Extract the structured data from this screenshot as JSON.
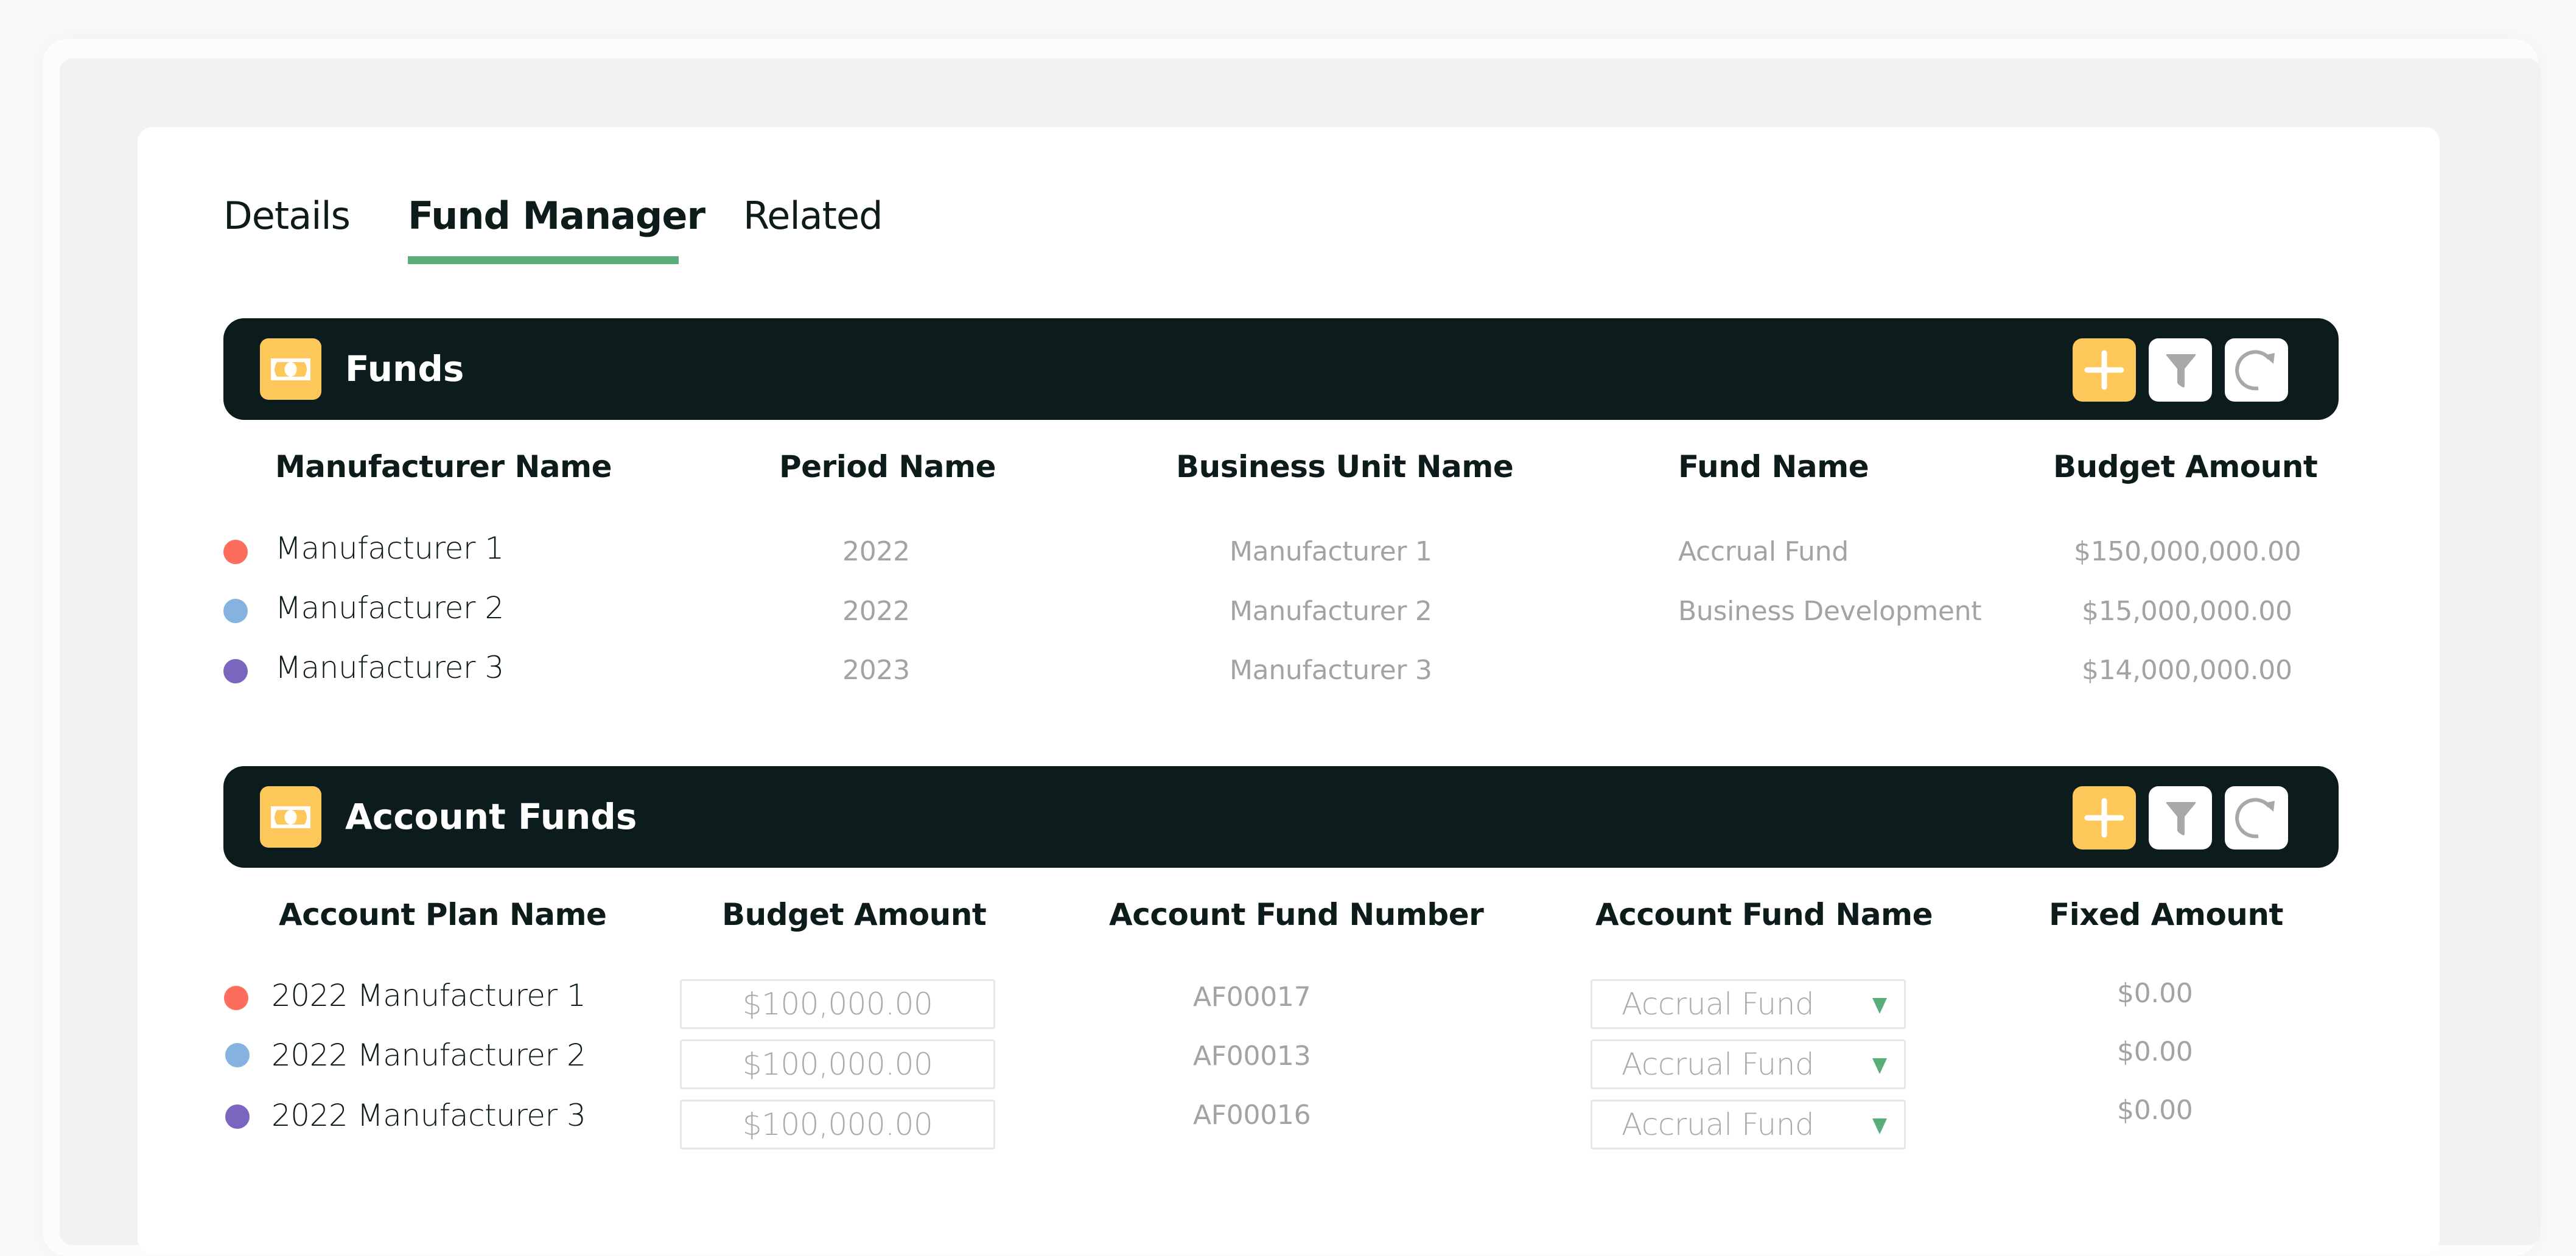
{
  "tabs": [
    {
      "label": "Details",
      "active": false
    },
    {
      "label": "Fund Manager",
      "active": true
    },
    {
      "label": "Related",
      "active": false
    }
  ],
  "colors": {
    "accent_green": "#58ad78",
    "header_bar": "#0c1c1c",
    "icon_yellow": "#fdc75a",
    "muted_text": "#a3a3a3",
    "dot_red": "#fd6d5e",
    "dot_blue": "#86b2e0",
    "dot_purple": "#7b66bf"
  },
  "funds": {
    "title": "Funds",
    "icon": "money-bill-icon",
    "actions": [
      {
        "name": "add",
        "icon": "plus-icon"
      },
      {
        "name": "filter",
        "icon": "filter-icon"
      },
      {
        "name": "refresh",
        "icon": "refresh-icon"
      }
    ],
    "columns": [
      "Manufacturer Name",
      "Period Name",
      "Business Unit Name",
      "Fund Name",
      "Budget Amount"
    ],
    "rows": [
      {
        "dot": "red",
        "manufacturer": "Manufacturer 1",
        "period": "2022",
        "business_unit": "Manufacturer 1",
        "fund_name": "Accrual Fund",
        "budget": "$150,000,000.00"
      },
      {
        "dot": "blue",
        "manufacturer": "Manufacturer 2",
        "period": "2022",
        "business_unit": "Manufacturer 2",
        "fund_name": "Business Development",
        "budget": "$15,000,000.00"
      },
      {
        "dot": "purple",
        "manufacturer": "Manufacturer 3",
        "period": "2023",
        "business_unit": "Manufacturer 3",
        "fund_name": "",
        "budget": "$14,000,000.00"
      }
    ]
  },
  "account_funds": {
    "title": "Account Funds",
    "icon": "money-bill-icon",
    "actions": [
      {
        "name": "add",
        "icon": "plus-icon"
      },
      {
        "name": "filter",
        "icon": "filter-icon"
      },
      {
        "name": "refresh",
        "icon": "refresh-icon"
      }
    ],
    "columns": [
      "Account Plan Name",
      "Budget Amount",
      "Account Fund Number",
      "Account Fund Name",
      "Fixed Amount"
    ],
    "rows": [
      {
        "dot": "red",
        "plan": "2022 Manufacturer 1",
        "budget": "$100,000.00",
        "number": "AF00017",
        "fund_name": "Accrual Fund",
        "fixed": "$0.00"
      },
      {
        "dot": "blue",
        "plan": "2022 Manufacturer 2",
        "budget": "$100,000.00",
        "number": "AF00013",
        "fund_name": "Accrual Fund",
        "fixed": "$0.00"
      },
      {
        "dot": "purple",
        "plan": "2022 Manufacturer 3",
        "budget": "$100,000.00",
        "number": "AF00016",
        "fund_name": "Accrual Fund",
        "fixed": "$0.00"
      }
    ]
  }
}
